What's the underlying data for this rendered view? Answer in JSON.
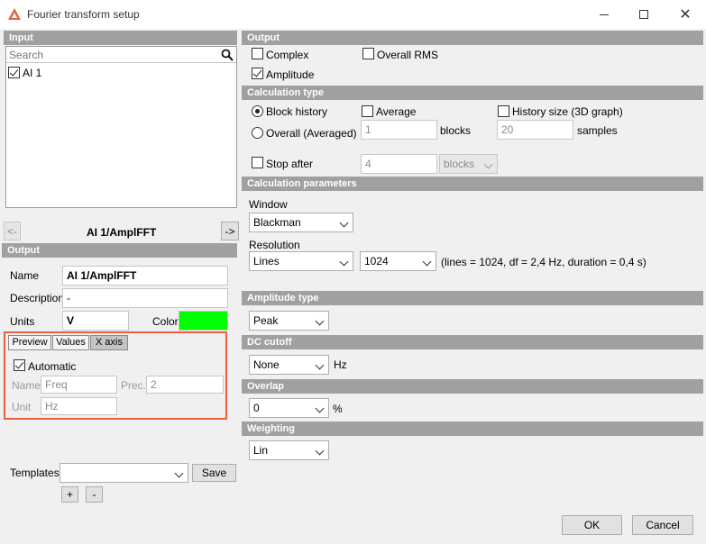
{
  "window": {
    "title": "Fourier transform setup"
  },
  "input": {
    "header": "Input",
    "search_placeholder": "Search",
    "channel": "AI 1",
    "nav": {
      "prev": "<-",
      "current": "AI 1/AmplFFT",
      "next": "->"
    }
  },
  "left_output": {
    "header": "Output",
    "name_label": "Name",
    "name_value": "AI 1/AmplFFT",
    "description_label": "Description",
    "description_value": "-",
    "units_label": "Units",
    "units_value": "V",
    "color_label": "Color",
    "color_value": "#00ff00",
    "tabs": [
      "Preview",
      "Values",
      "X axis"
    ],
    "automatic_label": "Automatic",
    "xname_label": "Name",
    "xname_value": "Freq",
    "prec_label": "Prec.",
    "prec_value": "2",
    "unit_label": "Unit",
    "unit_value": "Hz"
  },
  "templates": {
    "label": "Templates",
    "value": "",
    "save": "Save",
    "add": "+",
    "remove": "-"
  },
  "output": {
    "header": "Output",
    "complex": "Complex",
    "overall_rms": "Overall RMS",
    "amplitude": "Amplitude"
  },
  "calc_type": {
    "header": "Calculation type",
    "block_history": "Block history",
    "overall": "Overall (Averaged)",
    "average": "Average",
    "average_blocks": "1",
    "blocks": "blocks",
    "history_size": "History size (3D graph)",
    "history_samples": "20",
    "samples": "samples",
    "stop_after": "Stop after",
    "stop_value": "4",
    "stop_unit": "blocks"
  },
  "calc_params": {
    "header": "Calculation parameters",
    "window_label": "Window",
    "window_value": "Blackman",
    "resolution_label": "Resolution",
    "resolution_mode": "Lines",
    "resolution_value": "1024",
    "resolution_info": "(lines = 1024, df = 2,4 Hz, duration = 0,4 s)"
  },
  "amplitude_type": {
    "header": "Amplitude type",
    "value": "Peak"
  },
  "dc_cutoff": {
    "header": "DC cutoff",
    "value": "None",
    "unit": "Hz"
  },
  "overlap": {
    "header": "Overlap",
    "value": "0",
    "unit": "%"
  },
  "weighting": {
    "header": "Weighting",
    "value": "Lin"
  },
  "footer": {
    "ok": "OK",
    "cancel": "Cancel"
  },
  "colors": {
    "section_bg": "#a0a0a0",
    "highlight": "#e8603c",
    "accent": "#00ff00"
  }
}
